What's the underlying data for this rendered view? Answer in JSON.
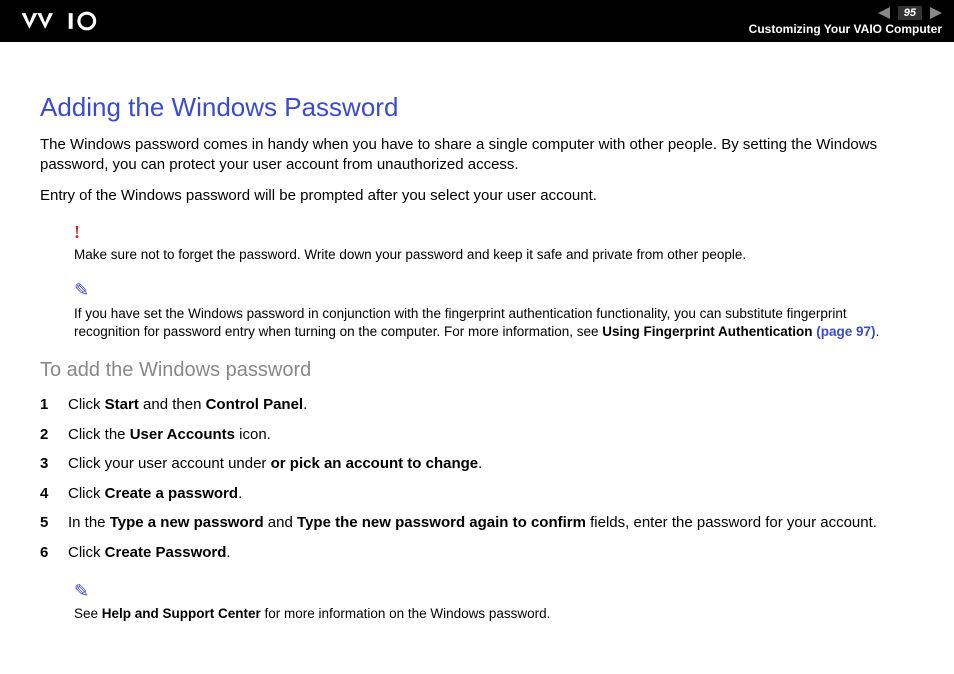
{
  "header": {
    "page_number": "95",
    "section_title": "Customizing Your VAIO Computer"
  },
  "main": {
    "heading": "Adding the Windows Password",
    "para1": "The Windows password comes in handy when you have to share a single computer with other people. By setting the Windows password, you can protect your user account from unauthorized access.",
    "para2": "Entry of the Windows password will be prompted after you select your user account.",
    "warning": "Make sure not to forget the password. Write down your password and keep it safe and private from other people.",
    "note1_pre": "If you have set the Windows password in conjunction with the fingerprint authentication functionality, you can substitute fingerprint recognition for password entry when turning on the computer. For more information, see ",
    "note1_bold": "Using Fingerprint Authentication ",
    "note1_link": "(page 97)",
    "note1_post": ".",
    "subheading": "To add the Windows password",
    "steps": [
      {
        "pre": "Click ",
        "b1": "Start",
        "mid": " and then ",
        "b2": "Control Panel",
        "post": "."
      },
      {
        "pre": "Click the ",
        "b1": "User Accounts",
        "mid": " icon.",
        "b2": "",
        "post": ""
      },
      {
        "pre": "Click your user account under ",
        "b1": "or pick an account to change",
        "mid": ".",
        "b2": "",
        "post": ""
      },
      {
        "pre": "Click ",
        "b1": "Create a password",
        "mid": ".",
        "b2": "",
        "post": ""
      },
      {
        "pre": "In the ",
        "b1": "Type a new password",
        "mid": " and ",
        "b2": "Type the new password again to confirm",
        "post": " fields, enter the password for your account."
      },
      {
        "pre": "Click ",
        "b1": "Create Password",
        "mid": ".",
        "b2": "",
        "post": ""
      }
    ],
    "note2_pre": "See ",
    "note2_bold": "Help and Support Center",
    "note2_post": " for more information on the Windows password."
  }
}
